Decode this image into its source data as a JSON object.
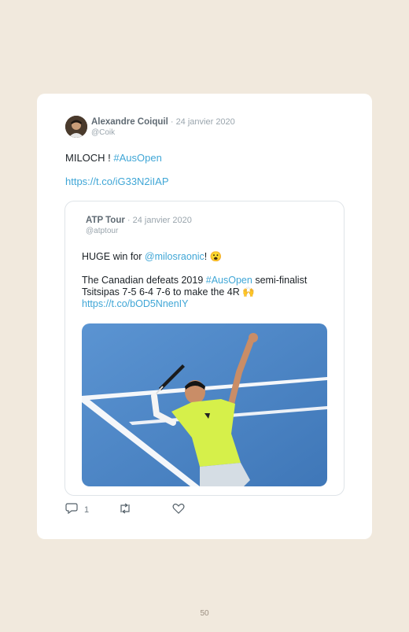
{
  "tweet": {
    "author_name": "Alexandre Coiquil",
    "separator": " · ",
    "date": "24 janvier 2020",
    "handle": "@Coik",
    "text_prefix": "MILOCH ! ",
    "hashtag": "#AusOpen",
    "link": "https://t.co/iG33N2iIAP",
    "reply_count": "1"
  },
  "quoted": {
    "author_name": "ATP Tour",
    "separator": " · ",
    "date": "24 janvier 2020",
    "handle": "@atptour",
    "line1_prefix": "HUGE win for ",
    "mention": "@milosraonic",
    "line1_suffix": "! 😮",
    "line2_prefix": "The Canadian defeats 2019 ",
    "hashtag": "#AusOpen",
    "line2_suffix": " semi-finalist",
    "line3": "Tsitsipas 7-5 6-4 7-6 to make the 4R 🙌",
    "link": "https://t.co/bOD5NnenIY"
  },
  "page_number": "50",
  "colors": {
    "background": "#f1e9dd",
    "card": "#ffffff",
    "link": "#3fa6d6",
    "court": "#4d86c6"
  },
  "icons": [
    "reply-icon",
    "retweet-icon",
    "like-icon"
  ]
}
